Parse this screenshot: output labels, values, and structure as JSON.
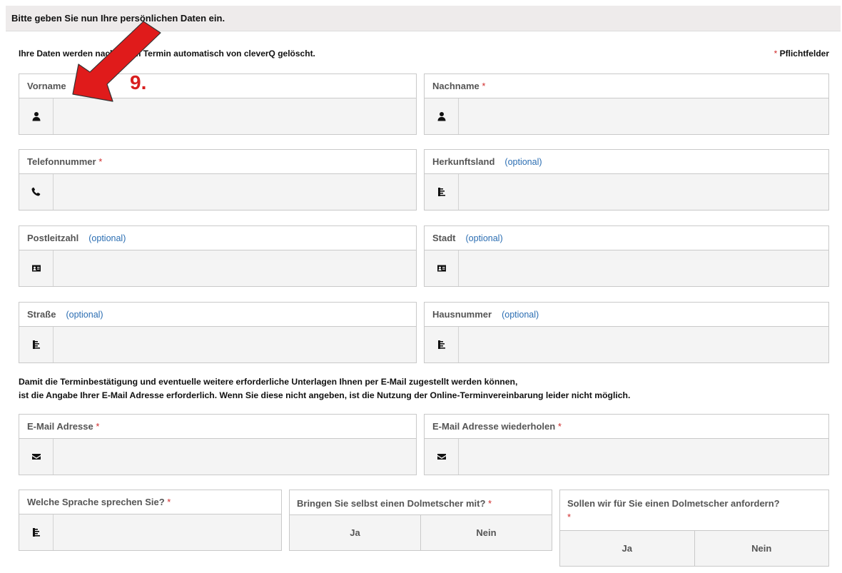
{
  "header": {
    "title": "Bitte geben Sie nun Ihre persönlichen Daten ein."
  },
  "info_text": "Ihre Daten werden nach Ihrem Termin automatisch von cleverQ gelöscht.",
  "required_note": {
    "star": "*",
    "label": "Pflichtfelder"
  },
  "annotation": {
    "step_label": "9.",
    "arrow_color": "#e01b1b"
  },
  "required_marker": "*",
  "fields": {
    "vorname": {
      "label": "Vorname",
      "icon": "user-icon"
    },
    "nachname": {
      "label": "Nachname",
      "icon": "user-icon"
    },
    "telefon": {
      "label": "Telefonnummer",
      "icon": "phone-icon"
    },
    "herkunftsland": {
      "label": "Herkunftsland",
      "optional": "(optional)",
      "icon": "list-icon"
    },
    "plz": {
      "label": "Postleitzahl",
      "optional": "(optional)",
      "icon": "address-card-icon"
    },
    "stadt": {
      "label": "Stadt",
      "optional": "(optional)",
      "icon": "address-card-icon"
    },
    "strasse": {
      "label": "Straße",
      "optional": "(optional)",
      "icon": "list-icon"
    },
    "hausnummer": {
      "label": "Hausnummer",
      "optional": "(optional)",
      "icon": "list-icon"
    },
    "email": {
      "label": "E-Mail Adresse",
      "icon": "envelope-icon"
    },
    "email_repeat": {
      "label": "E-Mail Adresse wiederholen",
      "icon": "envelope-icon"
    },
    "sprache": {
      "label": "Welche Sprache sprechen Sie?",
      "icon": "list-icon"
    }
  },
  "email_note": {
    "line1": "Damit die Terminbestätigung und eventuelle weitere erforderliche Unterlagen Ihnen per E-Mail zugestellt werden können,",
    "line2": "ist die Angabe Ihrer E-Mail Adresse erforderlich. Wenn Sie diese nicht angeben, ist die Nutzung der Online-Terminvereinbarung leider nicht möglich."
  },
  "choices": {
    "own_interpreter": {
      "label": "Bringen Sie selbst einen Dolmetscher mit?",
      "yes": "Ja",
      "no": "Nein"
    },
    "request_interpreter": {
      "label": "Sollen wir für Sie einen Dolmetscher anfordern?",
      "yes": "Ja",
      "no": "Nein"
    }
  },
  "colors": {
    "required_star": "#d02b2b",
    "optional_text": "#2a6db2",
    "header_bg": "#eeebeb"
  }
}
